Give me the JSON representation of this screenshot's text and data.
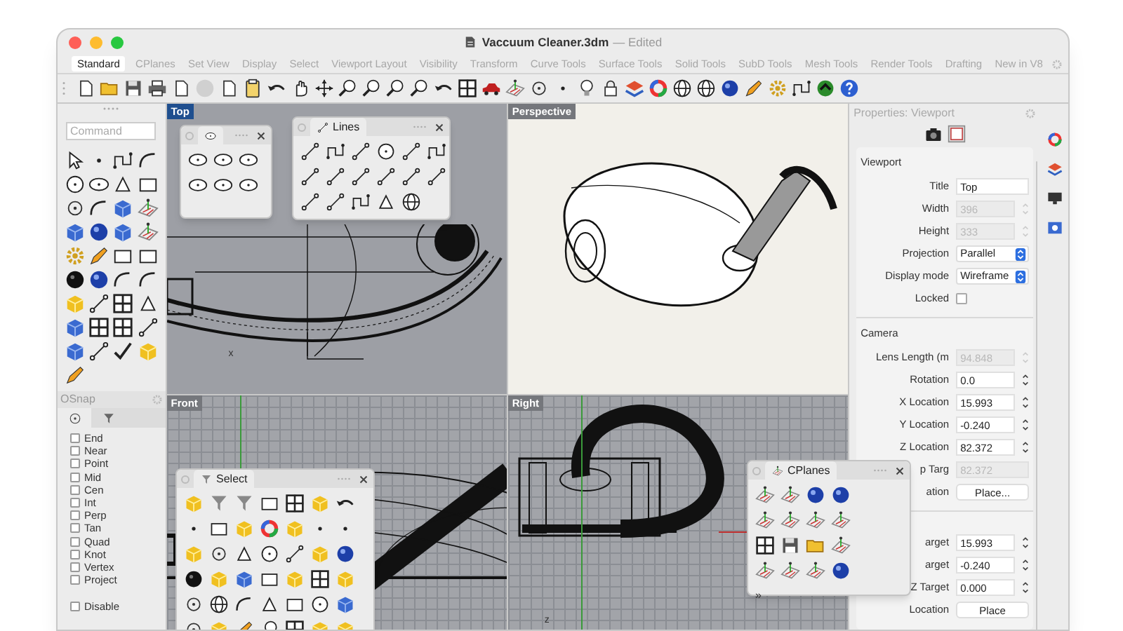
{
  "window": {
    "title": "Vaccuum Cleaner.3dm",
    "subtitle": "— Edited"
  },
  "tabs": [
    {
      "label": "Standard",
      "selected": true
    },
    {
      "label": "CPlanes",
      "selected": false
    },
    {
      "label": "Set View",
      "selected": false
    },
    {
      "label": "Display",
      "selected": false
    },
    {
      "label": "Select",
      "selected": false
    },
    {
      "label": "Viewport Layout",
      "selected": false
    },
    {
      "label": "Visibility",
      "selected": false
    },
    {
      "label": "Transform",
      "selected": false
    },
    {
      "label": "Curve Tools",
      "selected": false
    },
    {
      "label": "Surface Tools",
      "selected": false
    },
    {
      "label": "Solid Tools",
      "selected": false
    },
    {
      "label": "SubD Tools",
      "selected": false
    },
    {
      "label": "Mesh Tools",
      "selected": false
    },
    {
      "label": "Render Tools",
      "selected": false
    },
    {
      "label": "Drafting",
      "selected": false
    },
    {
      "label": "New in V8",
      "selected": false
    }
  ],
  "command": {
    "placeholder": "Command"
  },
  "osnap": {
    "title": "OSnap",
    "items": [
      {
        "label": "End",
        "checked": false
      },
      {
        "label": "Near",
        "checked": false
      },
      {
        "label": "Point",
        "checked": false
      },
      {
        "label": "Mid",
        "checked": false
      },
      {
        "label": "Cen",
        "checked": false
      },
      {
        "label": "Int",
        "checked": false
      },
      {
        "label": "Perp",
        "checked": false
      },
      {
        "label": "Tan",
        "checked": false
      },
      {
        "label": "Quad",
        "checked": false
      },
      {
        "label": "Knot",
        "checked": false
      },
      {
        "label": "Vertex",
        "checked": false
      },
      {
        "label": "Project",
        "checked": false
      }
    ],
    "disable": {
      "label": "Disable",
      "checked": false
    }
  },
  "viewports": [
    {
      "label": "Top",
      "selected": true,
      "axis_label": "x"
    },
    {
      "label": "Perspective",
      "selected": false
    },
    {
      "label": "Front",
      "selected": false
    },
    {
      "label": "Right",
      "selected": false,
      "axis_label": "z"
    }
  ],
  "palettes": [
    {
      "kind": "icon-tab"
    },
    {
      "kind": "titled",
      "title": "Lines"
    },
    {
      "kind": "titled",
      "title": "Select"
    },
    {
      "kind": "titled",
      "title": "CPlanes",
      "overflow_glyph": "»"
    }
  ],
  "properties": {
    "title": "Properties: Viewport",
    "sections": [
      {
        "title": "Viewport",
        "rows": [
          {
            "label": "Title",
            "kind": "text",
            "value": "Top",
            "disabled": false
          },
          {
            "label": "Width",
            "kind": "stepper",
            "value": "396",
            "disabled": true
          },
          {
            "label": "Height",
            "kind": "stepper",
            "value": "333",
            "disabled": true
          },
          {
            "label": "Projection",
            "kind": "select",
            "value": "Parallel",
            "disabled": false
          },
          {
            "label": "Display mode",
            "kind": "select",
            "value": "Wireframe",
            "disabled": false
          },
          {
            "label": "Locked",
            "kind": "checkbox",
            "checked": false,
            "disabled": false
          }
        ]
      },
      {
        "title": "Camera",
        "rows": [
          {
            "label": "Lens Length (m",
            "kind": "stepper",
            "value": "94.848",
            "disabled": true
          },
          {
            "label": "Rotation",
            "kind": "stepper",
            "value": "0.0",
            "disabled": false
          },
          {
            "label": "X Location",
            "kind": "stepper",
            "value": "15.993",
            "disabled": false
          },
          {
            "label": "Y Location",
            "kind": "stepper",
            "value": "-0.240",
            "disabled": false
          },
          {
            "label": "Z Location",
            "kind": "stepper",
            "value": "82.372",
            "disabled": false
          },
          {
            "label": "p Targ",
            "kind": "text",
            "value": "82.372",
            "disabled": true
          },
          {
            "label": "ation",
            "kind": "button",
            "value": "Place...",
            "disabled": false
          }
        ]
      },
      {
        "rows": [
          {
            "label": "arget",
            "kind": "stepper",
            "value": "15.993",
            "disabled": false
          },
          {
            "label": "arget",
            "kind": "stepper",
            "value": "-0.240",
            "disabled": false
          },
          {
            "label": "Z Target",
            "kind": "stepper",
            "value": "0.000",
            "disabled": false
          },
          {
            "label": "Location",
            "kind": "button",
            "value": "Place",
            "disabled": false
          }
        ]
      }
    ]
  }
}
